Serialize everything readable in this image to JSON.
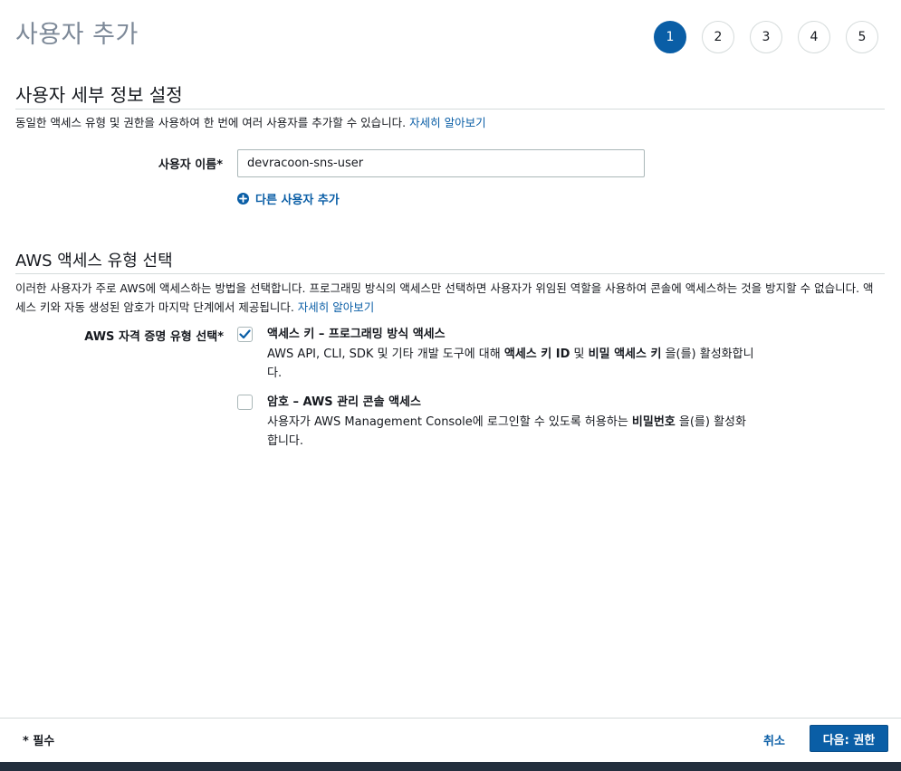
{
  "page": {
    "title": "사용자 추가"
  },
  "steps": [
    "1",
    "2",
    "3",
    "4",
    "5"
  ],
  "details": {
    "heading": "사용자 세부 정보 설정",
    "description": "동일한 액세스 유형 및 권한을 사용하여 한 번에 여러 사용자를 추가할 수 있습니다.",
    "learn_more": "자세히 알아보기",
    "username_label": "사용자 이름*",
    "username_value": "devracoon-sns-user",
    "add_user_label": "다른 사용자 추가"
  },
  "access": {
    "heading": "AWS 액세스 유형 선택",
    "description": "이러한 사용자가 주로 AWS에 액세스하는 방법을 선택합니다. 프로그래밍 방식의 액세스만 선택하면 사용자가 위임된 역할을 사용하여 콘솔에 액세스하는 것을 방지할 수 없습니다. 액세스 키와 자동 생성된 암호가 마지막 단계에서 제공됩니다.",
    "learn_more": "자세히 알아보기",
    "credential_label": "AWS 자격 증명 유형 선택*",
    "options": [
      {
        "title": "액세스 키 – 프로그래밍 방식 액세스",
        "desc_pre": "AWS API, CLI, SDK 및 기타 개발 도구에 대해 ",
        "desc_bold1": "액세스 키 ID",
        "desc_mid": " 및 ",
        "desc_bold2": "비밀 액세스 키",
        "desc_post": " 을(를) 활성화합니다.",
        "checked": true
      },
      {
        "title": "암호 – AWS 관리 콘솔 액세스",
        "desc_pre": "사용자가 AWS Management Console에 로그인할 수 있도록 허용하는 ",
        "desc_bold": "비밀번호",
        "desc_post": " 을(를) 활성화합니다.",
        "checked": false
      }
    ]
  },
  "footer": {
    "required_note": "* 필수",
    "cancel_label": "취소",
    "next_label": "다음: 권한"
  },
  "colors": {
    "accent": "#0a5ea6",
    "border": "#d5dbdb",
    "title_gray": "#7d8998",
    "bottom_bar": "#232f3e"
  }
}
